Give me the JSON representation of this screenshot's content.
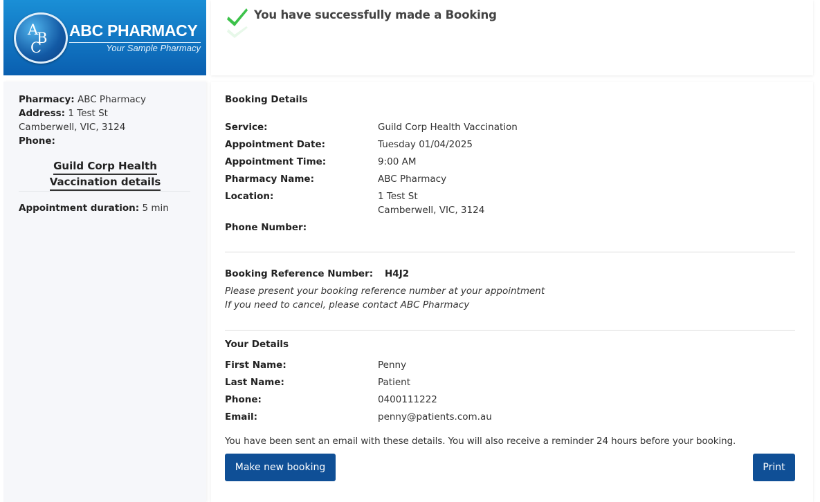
{
  "logo": {
    "letters": [
      "A",
      "B",
      "C"
    ],
    "brand": "ABC PHARMACY",
    "tagline": "Your Sample Pharmacy"
  },
  "header": {
    "success_message": "You have successfully made a Booking"
  },
  "sidebar": {
    "pharmacy_label": "Pharmacy:",
    "pharmacy_value": "ABC Pharmacy",
    "address_label": "Address:",
    "address_line1": "1 Test St",
    "address_line2": "Camberwell, VIC, 3124",
    "phone_label": "Phone:",
    "service_title_line1": "Guild Corp Health",
    "service_title_line2": "Vaccination details",
    "duration_label": "Appointment duration:",
    "duration_value": "5 min"
  },
  "booking": {
    "section_title": "Booking Details",
    "service_label": "Service:",
    "service_value": "Guild Corp Health Vaccination",
    "date_label": "Appointment Date:",
    "date_value": "Tuesday 01/04/2025",
    "time_label": "Appointment Time:",
    "time_value": "9:00 AM",
    "pharmacy_label": "Pharmacy Name:",
    "pharmacy_value": "ABC Pharmacy",
    "location_label": "Location:",
    "location_line1": "1 Test St",
    "location_line2": "Camberwell, VIC, 3124",
    "phone_label": "Phone Number:"
  },
  "reference": {
    "label": "Booking Reference Number:",
    "value": "H4J2",
    "note1": "Please present your booking reference number at your appointment",
    "note2": "If you need to cancel, please contact ABC Pharmacy"
  },
  "details": {
    "section_title": "Your Details",
    "first_name_label": "First Name:",
    "first_name_value": "Penny",
    "last_name_label": "Last Name:",
    "last_name_value": "Patient",
    "phone_label": "Phone:",
    "phone_value": "0400111222",
    "email_label": "Email:",
    "email_value": "penny@patients.com.au"
  },
  "notice": "You have been sent an email with these details. You will also receive a reminder 24 hours before your booking.",
  "buttons": {
    "new_booking": "Make new booking",
    "print": "Print"
  },
  "colors": {
    "primary_button": "#0f4f96",
    "logo_blue": "#1a8fd6",
    "check_green": "#3cc24a"
  }
}
